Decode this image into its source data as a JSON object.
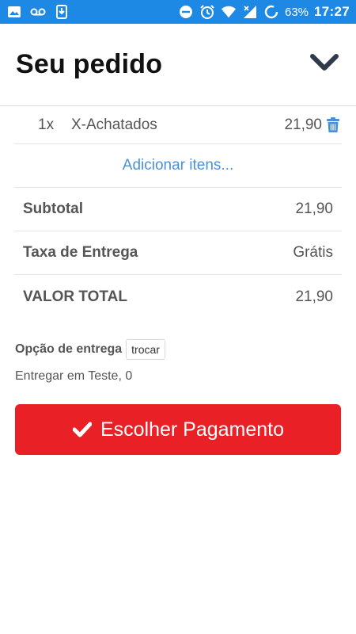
{
  "status_bar": {
    "battery_percent": "63%",
    "time": "17:27",
    "left_icons": [
      "image-icon",
      "voicemail-icon",
      "download-icon"
    ],
    "right_icons": [
      "dnd-icon",
      "alarm-icon",
      "wifi-icon",
      "signal-icon",
      "sync-icon"
    ]
  },
  "header": {
    "title": "Seu pedido",
    "collapse_icon": "chevron-down-icon"
  },
  "order": {
    "items": [
      {
        "qty": "1x",
        "name": "X-Achatados",
        "price": "21,90"
      }
    ],
    "add_items_label": "Adicionar itens...",
    "subtotal_label": "Subtotal",
    "subtotal_value": "21,90",
    "delivery_fee_label": "Taxa de Entrega",
    "delivery_fee_value": "Grátis",
    "total_label": "VALOR TOTAL",
    "total_value": "21,90"
  },
  "delivery": {
    "option_label": "Opção de entrega",
    "change_button": "trocar",
    "address": "Entregar em Teste, 0"
  },
  "payment": {
    "button_label": "Escolher Pagamento"
  },
  "colors": {
    "status_bar": "#1e88e5",
    "link": "#4a90d9",
    "primary_button": "#ea2027"
  }
}
